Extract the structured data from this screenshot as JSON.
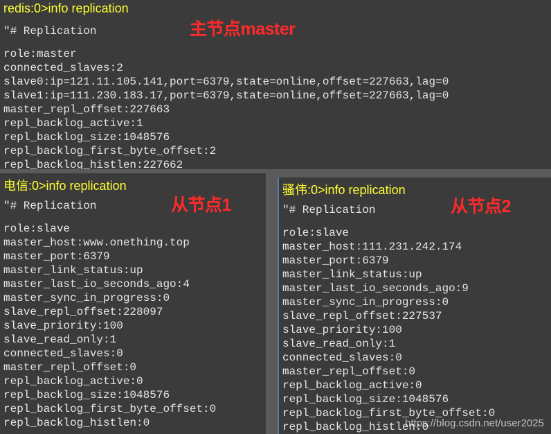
{
  "panes": {
    "master": {
      "command": "redis:0>info replication",
      "tag": "主节点master",
      "header": "\"# Replication",
      "lines": [
        "role:master",
        "connected_slaves:2",
        "slave0:ip=121.11.105.141,port=6379,state=online,offset=227663,lag=0",
        "slave1:ip=111.230.183.17,port=6379,state=online,offset=227663,lag=0",
        "master_repl_offset:227663",
        "repl_backlog_active:1",
        "repl_backlog_size:1048576",
        "repl_backlog_first_byte_offset:2",
        "repl_backlog_histlen:227662"
      ]
    },
    "slave1": {
      "command": "电信:0>info replication",
      "tag": "从节点1",
      "header": "\"# Replication",
      "lines": [
        "role:slave",
        "master_host:www.onething.top",
        "master_port:6379",
        "master_link_status:up",
        "master_last_io_seconds_ago:4",
        "master_sync_in_progress:0",
        "slave_repl_offset:228097",
        "slave_priority:100",
        "slave_read_only:1",
        "connected_slaves:0",
        "master_repl_offset:0",
        "repl_backlog_active:0",
        "repl_backlog_size:1048576",
        "repl_backlog_first_byte_offset:0",
        "repl_backlog_histlen:0"
      ]
    },
    "slave2": {
      "command": "骚伟:0>info replication",
      "tag": "从节点2",
      "header": "\"# Replication",
      "lines": [
        "role:slave",
        "master_host:111.231.242.174",
        "master_port:6379",
        "master_link_status:up",
        "master_last_io_seconds_ago:9",
        "master_sync_in_progress:0",
        "slave_repl_offset:227537",
        "slave_priority:100",
        "slave_read_only:1",
        "connected_slaves:0",
        "master_repl_offset:0",
        "repl_backlog_active:0",
        "repl_backlog_size:1048576",
        "repl_backlog_first_byte_offset:0",
        "repl_backlog_histlen:0"
      ]
    }
  },
  "watermark": "https://blog.csdn.net/user2025",
  "colors": {
    "background": "#3b3b3b",
    "command_text": "#ffff32",
    "tag_text": "#ff2a2a",
    "output_text": "#e6e6e6",
    "divider": "#5a5a5a",
    "active_pane_border": "#5d7da8"
  }
}
